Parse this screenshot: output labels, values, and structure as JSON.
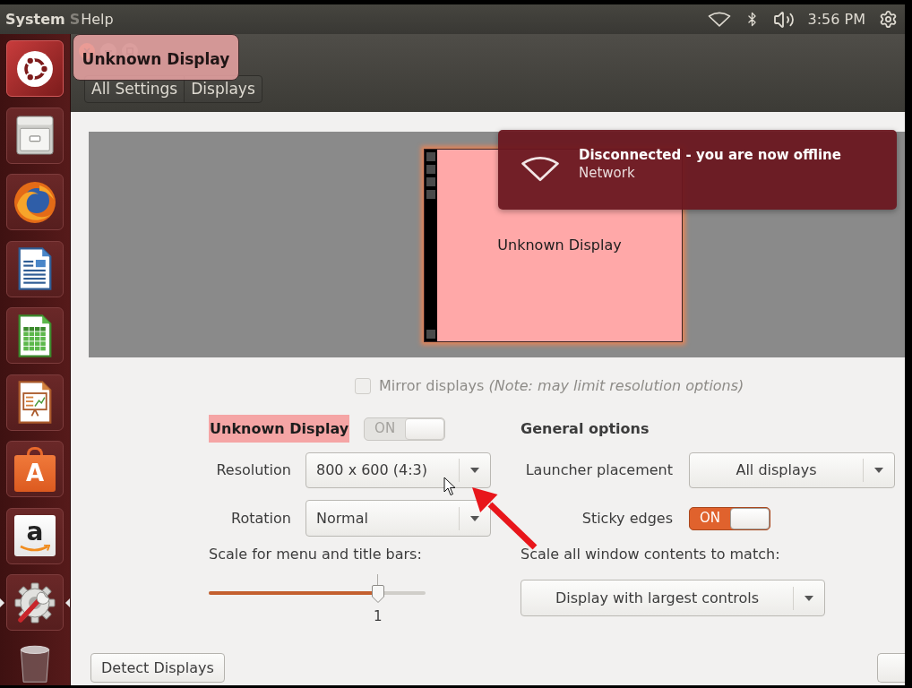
{
  "top_panel": {
    "app_name": "System",
    "app_name_faded": "S",
    "menus": [
      {
        "label": "Help"
      }
    ],
    "clock": "3:56 PM"
  },
  "launcher": {
    "items": [
      {
        "kind": "dash",
        "running": false
      },
      {
        "kind": "files",
        "running": false
      },
      {
        "kind": "browser",
        "running": false
      },
      {
        "kind": "writer",
        "running": false
      },
      {
        "kind": "spreadsheet",
        "running": false
      },
      {
        "kind": "presentation",
        "running": false
      },
      {
        "kind": "software",
        "glyph": "A",
        "running": false
      },
      {
        "kind": "amazon",
        "glyph": "a",
        "running": false
      },
      {
        "kind": "settings",
        "running": true
      },
      {
        "kind": "trash",
        "running": false
      }
    ]
  },
  "window": {
    "tooltip": "Unknown Display",
    "breadcrumbs": [
      {
        "label": "All Settings"
      },
      {
        "label": "Displays"
      }
    ]
  },
  "preview": {
    "monitor_label": "Unknown Display"
  },
  "notification": {
    "title": "Disconnected - you are now offline",
    "source": "Network"
  },
  "mirror": {
    "label": "Mirror displays",
    "note": "(Note: may limit resolution options)",
    "checked": false,
    "disabled": true
  },
  "display": {
    "name": "Unknown Display",
    "switch": {
      "label": "ON",
      "on": true,
      "disabled": true
    },
    "fields": [
      {
        "label": "Resolution",
        "value": "800 x 600 (4:3)"
      },
      {
        "label": "Rotation",
        "value": "Normal"
      }
    ],
    "scale": {
      "label": "Scale for menu and title bars:",
      "level": 0.78,
      "reading": "1"
    }
  },
  "general": {
    "title": "General options",
    "launcher_placement": {
      "label": "Launcher placement",
      "value": "All displays"
    },
    "sticky_edges": {
      "label": "Sticky edges",
      "switch": {
        "label": "ON",
        "on": true,
        "disabled": false
      }
    },
    "scale_all": {
      "label": "Scale all window contents to match:",
      "value": "Display with largest controls"
    }
  },
  "buttons": [
    {
      "label": "Detect Displays"
    }
  ]
}
